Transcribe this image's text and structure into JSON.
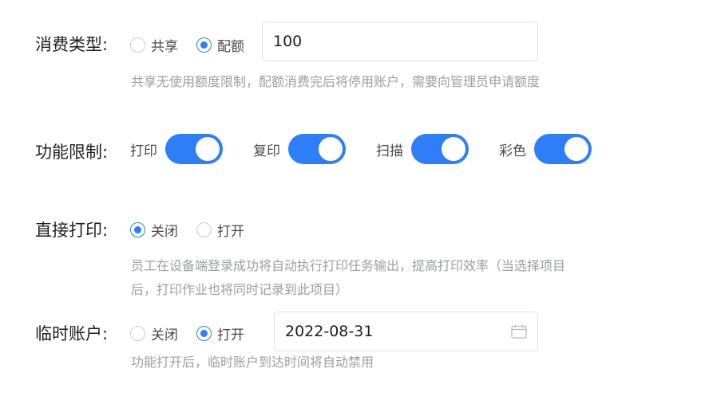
{
  "consumption": {
    "label": "消费类型:",
    "options": [
      "共享",
      "配额"
    ],
    "selected": "配额",
    "quota_value": "100",
    "hint": "共享无使用额度限制，配额消费完后将停用账户，需要向管理员申请额度"
  },
  "functions": {
    "label": "功能限制:",
    "items": [
      {
        "label": "打印",
        "on": true
      },
      {
        "label": "复印",
        "on": true
      },
      {
        "label": "扫描",
        "on": true
      },
      {
        "label": "彩色",
        "on": true
      }
    ]
  },
  "direct_print": {
    "label": "直接打印:",
    "options": [
      "关闭",
      "打开"
    ],
    "selected": "关闭",
    "hint_line1": "员工在设备端登录成功将自动执行打印任务输出，提高打印效率（当选择项目",
    "hint_line2": "后，打印作业也将同时记录到此项目）"
  },
  "temp_account": {
    "label": "临时账户:",
    "options": [
      "关闭",
      "打开"
    ],
    "selected": "打开",
    "date_value": "2022-08-31",
    "hint": "功能打开后，临时账户到达时间将自动禁用"
  },
  "colors": {
    "accent": "#2d7ef7",
    "hint_text": "#9b9ea3",
    "border": "#dcdfe6"
  }
}
